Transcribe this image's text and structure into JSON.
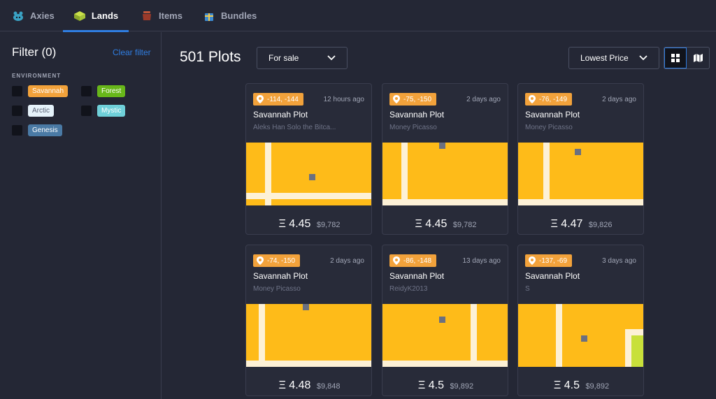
{
  "nav": {
    "tabs": [
      {
        "label": "Axies",
        "icon": "axie-icon",
        "active": false
      },
      {
        "label": "Lands",
        "icon": "land-icon",
        "active": true
      },
      {
        "label": "Items",
        "icon": "item-pot-icon",
        "active": false
      },
      {
        "label": "Bundles",
        "icon": "bundle-icon",
        "active": false
      }
    ]
  },
  "sidebar": {
    "filter_title": "Filter (0)",
    "clear_filter": "Clear filter",
    "environment_label": "ENVIRONMENT",
    "environments": [
      {
        "label": "Savannah",
        "color": "#f2a23b",
        "text_color": "#ffffff"
      },
      {
        "label": "Forest",
        "color": "#68b71a",
        "text_color": "#ffffff"
      },
      {
        "label": "Arctic",
        "color": "#e5f2fa",
        "text_color": "#5b6275"
      },
      {
        "label": "Mystic",
        "color": "#6fd0d9",
        "text_color": "#ffffff"
      },
      {
        "label": "Genesis",
        "color": "#4a7aa5",
        "text_color": "#ffffff"
      }
    ]
  },
  "main": {
    "title": "501 Plots",
    "status_dropdown": "For sale",
    "sort_dropdown": "Lowest Price",
    "view_grid_icon": "grid-icon",
    "view_map_icon": "map-icon"
  },
  "cards": [
    {
      "coords": "-114, -144",
      "time": "12 hours ago",
      "title": "Savannah Plot",
      "owner": "Aleks Han Solo the Bitca...",
      "eth": "Ξ 4.45",
      "usd": "$9,782"
    },
    {
      "coords": "-75, -150",
      "time": "2 days ago",
      "title": "Savannah Plot",
      "owner": "Money Picasso",
      "eth": "Ξ 4.45",
      "usd": "$9,782"
    },
    {
      "coords": "-76, -149",
      "time": "2 days ago",
      "title": "Savannah Plot",
      "owner": "Money Picasso",
      "eth": "Ξ 4.47",
      "usd": "$9,826"
    },
    {
      "coords": "-74, -150",
      "time": "2 days ago",
      "title": "Savannah Plot",
      "owner": "Money Picasso",
      "eth": "Ξ 4.48",
      "usd": "$9,848"
    },
    {
      "coords": "-86, -148",
      "time": "13 days ago",
      "title": "Savannah Plot",
      "owner": "ReidyK2013",
      "eth": "Ξ 4.5",
      "usd": "$9,892"
    },
    {
      "coords": "-137, -69",
      "time": "3 days ago",
      "title": "Savannah Plot",
      "owner": "S",
      "eth": "Ξ 4.5",
      "usd": "$9,892"
    }
  ],
  "colors": {
    "accent": "#2f7de1",
    "savannah": "#febb19",
    "road": "#fdf1d6",
    "marker": "#6b7080",
    "forest": "#c8e03a"
  }
}
